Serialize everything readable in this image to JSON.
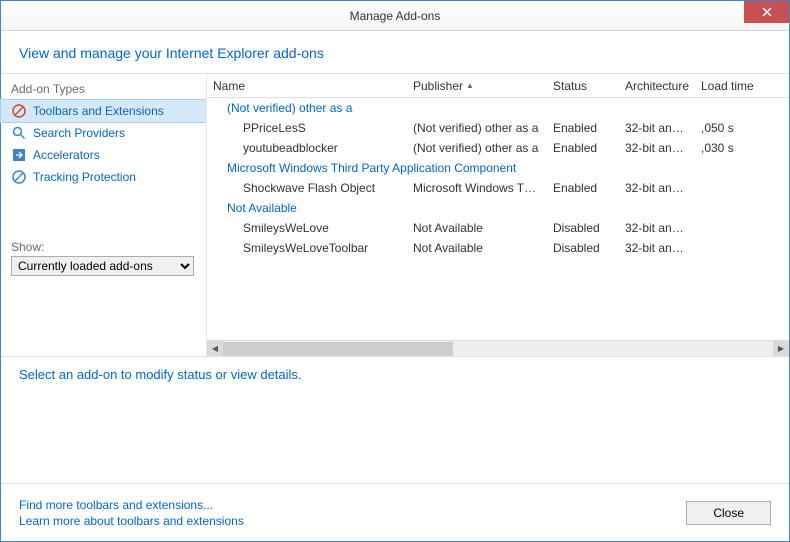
{
  "window": {
    "title": "Manage Add-ons"
  },
  "header": {
    "text": "View and manage your Internet Explorer add-ons"
  },
  "sidebar": {
    "types_label": "Add-on Types",
    "items": [
      {
        "label": "Toolbars and Extensions",
        "icon": "toolbars"
      },
      {
        "label": "Search Providers",
        "icon": "search"
      },
      {
        "label": "Accelerators",
        "icon": "accel"
      },
      {
        "label": "Tracking Protection",
        "icon": "track"
      }
    ],
    "show_label": "Show:",
    "show_value": "Currently loaded add-ons"
  },
  "table": {
    "columns": {
      "name": "Name",
      "publisher": "Publisher",
      "status": "Status",
      "architecture": "Architecture",
      "load_time": "Load time"
    },
    "groups": [
      {
        "title": "(Not verified) other as a",
        "rows": [
          {
            "name": "PPriceLesS",
            "publisher": "(Not verified) other as a",
            "status": "Enabled",
            "arch": "32-bit and ...",
            "load": ",050 s"
          },
          {
            "name": "youtubeadblocker",
            "publisher": "(Not verified) other as a",
            "status": "Enabled",
            "arch": "32-bit and ...",
            "load": ",030 s"
          }
        ]
      },
      {
        "title": "Microsoft Windows Third Party Application Component",
        "rows": [
          {
            "name": "Shockwave Flash Object",
            "publisher": "Microsoft Windows Third...",
            "status": "Enabled",
            "arch": "32-bit and ...",
            "load": ""
          }
        ]
      },
      {
        "title": "Not Available",
        "rows": [
          {
            "name": "SmileysWeLove",
            "publisher": "Not Available",
            "status": "Disabled",
            "arch": "32-bit and ...",
            "load": ""
          },
          {
            "name": "SmileysWeLoveToolbar",
            "publisher": "Not Available",
            "status": "Disabled",
            "arch": "32-bit and ...",
            "load": ""
          }
        ]
      }
    ]
  },
  "detail": {
    "prompt": "Select an add-on to modify status or view details."
  },
  "footer": {
    "link1": "Find more toolbars and extensions...",
    "link2": "Learn more about toolbars and extensions",
    "close": "Close"
  }
}
